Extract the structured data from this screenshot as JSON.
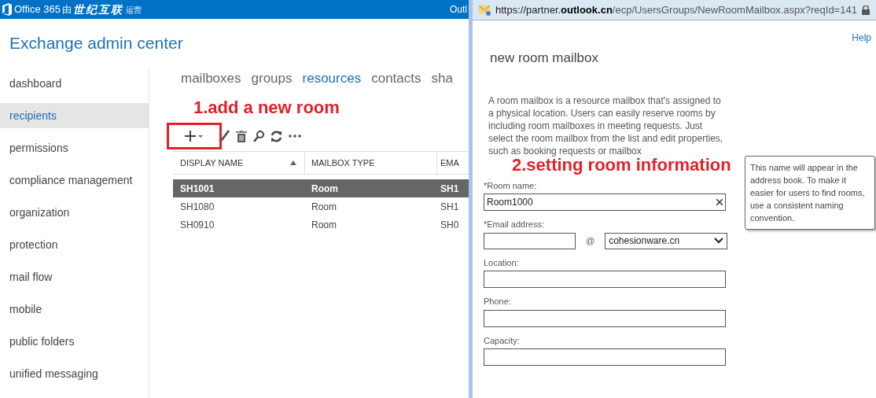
{
  "top_bar": {
    "brand": "Office 365",
    "brand_suffix": "由",
    "partner": "世纪互联",
    "operated": "运营",
    "right_text": "Outl"
  },
  "app_title": "Exchange admin center",
  "sidebar": {
    "items": [
      {
        "label": "dashboard",
        "selected": false
      },
      {
        "label": "recipients",
        "selected": true
      },
      {
        "label": "permissions",
        "selected": false
      },
      {
        "label": "compliance management",
        "selected": false
      },
      {
        "label": "organization",
        "selected": false
      },
      {
        "label": "protection",
        "selected": false
      },
      {
        "label": "mail flow",
        "selected": false
      },
      {
        "label": "mobile",
        "selected": false
      },
      {
        "label": "public folders",
        "selected": false
      },
      {
        "label": "unified messaging",
        "selected": false
      }
    ]
  },
  "tabs": [
    {
      "label": "mailboxes",
      "selected": false
    },
    {
      "label": "groups",
      "selected": false
    },
    {
      "label": "resources",
      "selected": true
    },
    {
      "label": "contacts",
      "selected": false
    },
    {
      "label": "sha",
      "selected": false
    }
  ],
  "annotation_1": "1.add a new room",
  "table": {
    "columns": [
      "DISPLAY NAME",
      "MAILBOX TYPE",
      "EMA"
    ],
    "rows": [
      {
        "cells": [
          "SH1001",
          "Room",
          "SH1"
        ],
        "selected": true
      },
      {
        "cells": [
          "SH1080",
          "Room",
          "SH1"
        ],
        "selected": false
      },
      {
        "cells": [
          "SH0910",
          "Room",
          "SH0"
        ],
        "selected": false
      }
    ]
  },
  "popup": {
    "url_prefix": "https://partner.",
    "url_domain": "outlook.cn",
    "url_path": "/ecp/UsersGroups/NewRoomMailbox.aspx?reqId=141",
    "help": "Help",
    "title": "new room mailbox",
    "description": "A room mailbox is a resource mailbox that's assigned to a physical location. Users can easily reserve rooms by including room mailboxes in meeting requests. Just select the room mailbox from the list and edit properties, such as booking requests or mailbox",
    "annotation_2": "2.setting room information",
    "tooltip": "This name will appear in the address book. To make it easier for users to find rooms, use a consistent naming convention.",
    "room_name": {
      "label": "*Room name:",
      "value": "Room1000"
    },
    "email": {
      "label": "*Email address:",
      "at": "@",
      "domain": "cohesionware.cn"
    },
    "fields": [
      {
        "label": "Location:"
      },
      {
        "label": "Phone:"
      },
      {
        "label": "Capacity:"
      }
    ]
  }
}
